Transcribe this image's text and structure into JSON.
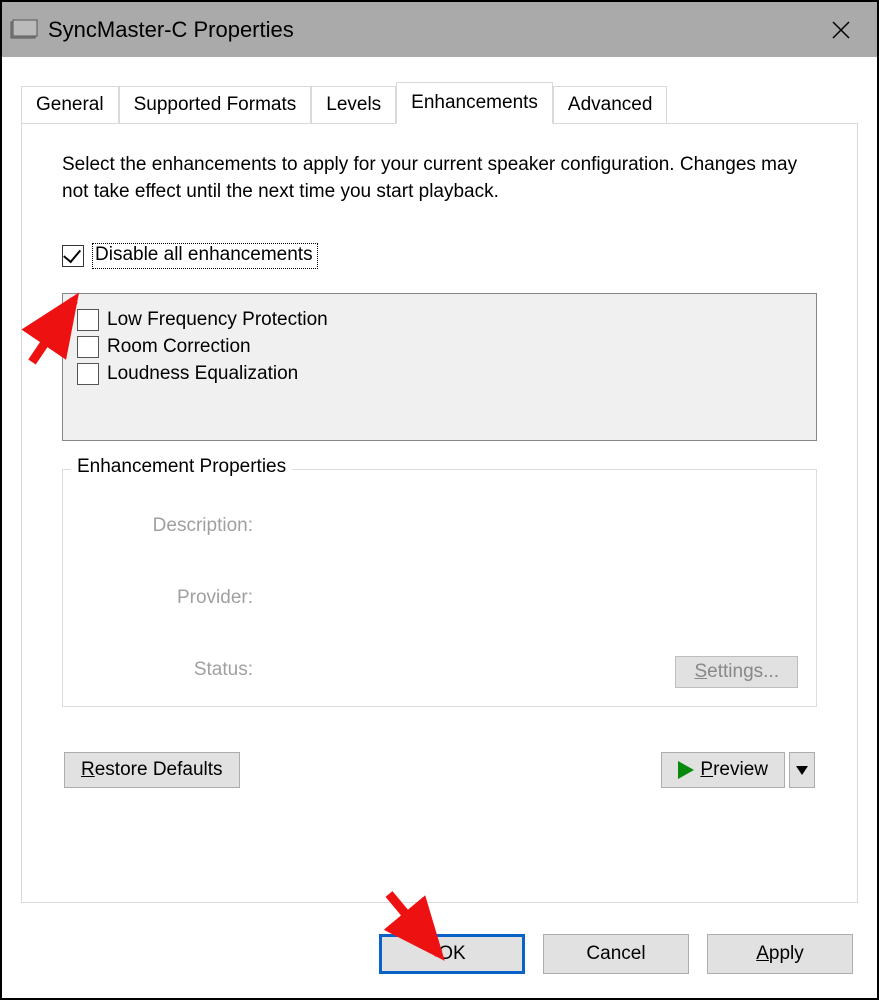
{
  "title": "SyncMaster-C Properties",
  "tabs": [
    "General",
    "Supported Formats",
    "Levels",
    "Enhancements",
    "Advanced"
  ],
  "active_tab_index": 3,
  "instruction": "Select the enhancements to apply for your current speaker configuration. Changes may not take effect until the next time you start playback.",
  "disable_all": {
    "label": "Disable all enhancements",
    "checked": true
  },
  "enhancements": [
    {
      "label": "Low Frequency Protection",
      "checked": false
    },
    {
      "label": "Room Correction",
      "checked": false
    },
    {
      "label": "Loudness Equalization",
      "checked": false
    }
  ],
  "group": {
    "legend": "Enhancement Properties",
    "description_label": "Description:",
    "provider_label": "Provider:",
    "status_label": "Status:",
    "settings_btn_prefix": "S",
    "settings_btn_rest": "ettings..."
  },
  "restore_prefix": "R",
  "restore_rest": "estore Defaults",
  "preview_prefix": "P",
  "preview_rest": "review",
  "buttons": {
    "ok": "OK",
    "cancel": "Cancel",
    "apply_prefix": "A",
    "apply_rest": "pply"
  }
}
